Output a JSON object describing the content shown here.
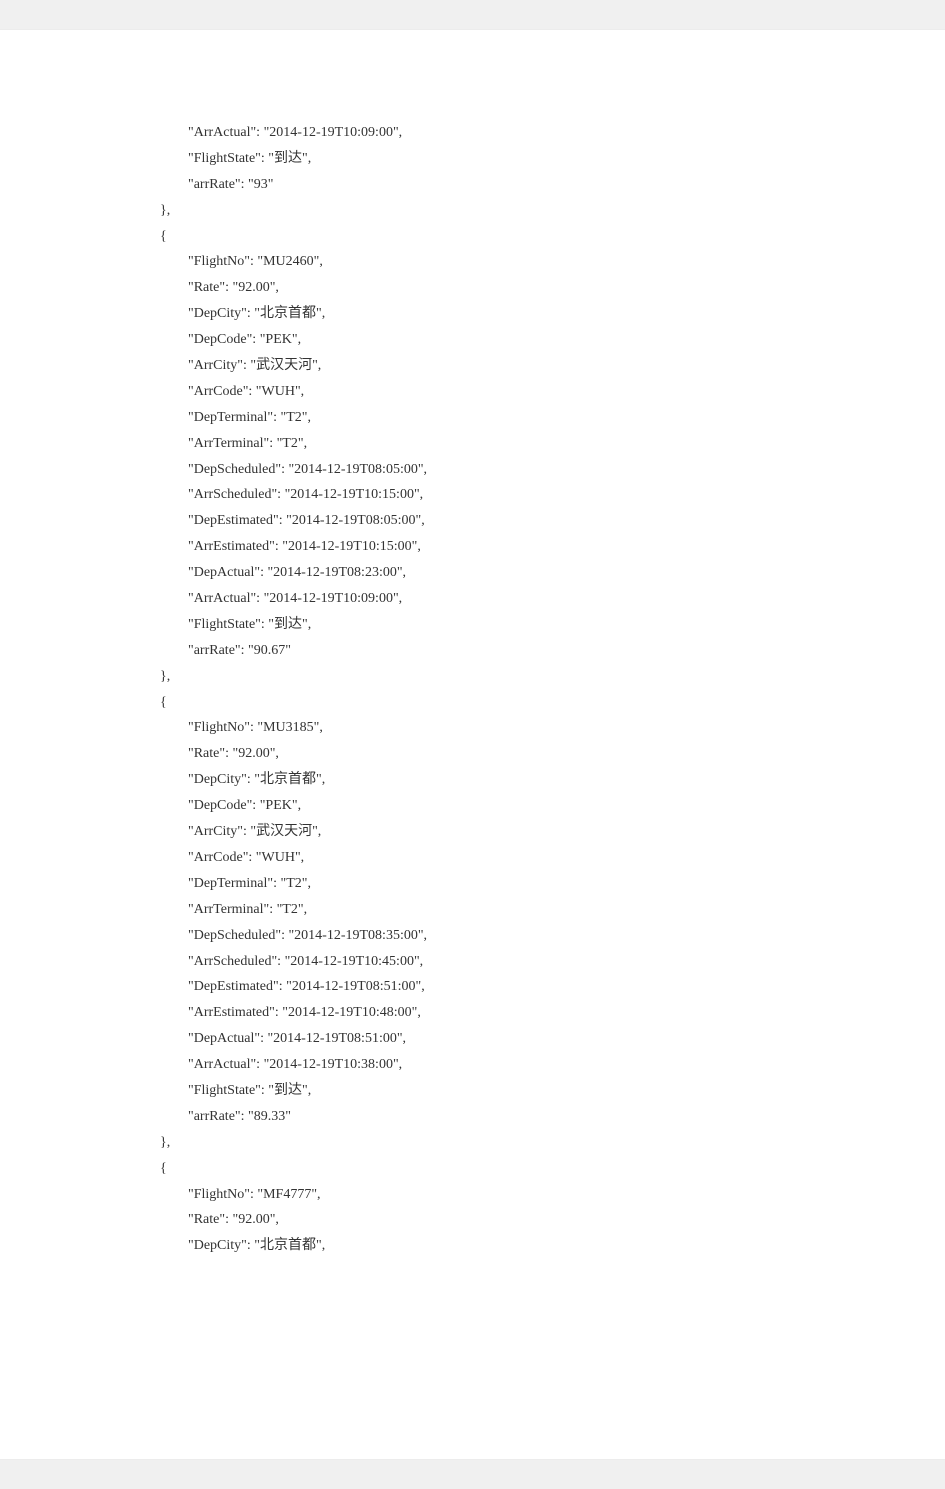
{
  "page": {
    "lines": [
      "        \"ArrActual\": \"2014-12-19T10:09:00\",",
      "        \"FlightState\": \"到达\",",
      "        \"arrRate\": \"93\"",
      "},",
      "{",
      "        \"FlightNo\": \"MU2460\",",
      "        \"Rate\": \"92.00\",",
      "        \"DepCity\": \"北京首都\",",
      "        \"DepCode\": \"PEK\",",
      "        \"ArrCity\": \"武汉天河\",",
      "        \"ArrCode\": \"WUH\",",
      "        \"DepTerminal\": \"T2\",",
      "        \"ArrTerminal\": \"T2\",",
      "        \"DepScheduled\": \"2014-12-19T08:05:00\",",
      "        \"ArrScheduled\": \"2014-12-19T10:15:00\",",
      "        \"DepEstimated\": \"2014-12-19T08:05:00\",",
      "        \"ArrEstimated\": \"2014-12-19T10:15:00\",",
      "        \"DepActual\": \"2014-12-19T08:23:00\",",
      "        \"ArrActual\": \"2014-12-19T10:09:00\",",
      "        \"FlightState\": \"到达\",",
      "        \"arrRate\": \"90.67\"",
      "},",
      "{",
      "        \"FlightNo\": \"MU3185\",",
      "        \"Rate\": \"92.00\",",
      "        \"DepCity\": \"北京首都\",",
      "        \"DepCode\": \"PEK\",",
      "        \"ArrCity\": \"武汉天河\",",
      "        \"ArrCode\": \"WUH\",",
      "        \"DepTerminal\": \"T2\",",
      "        \"ArrTerminal\": \"T2\",",
      "        \"DepScheduled\": \"2014-12-19T08:35:00\",",
      "        \"ArrScheduled\": \"2014-12-19T10:45:00\",",
      "        \"DepEstimated\": \"2014-12-19T08:51:00\",",
      "        \"ArrEstimated\": \"2014-12-19T10:48:00\",",
      "        \"DepActual\": \"2014-12-19T08:51:00\",",
      "        \"ArrActual\": \"2014-12-19T10:38:00\",",
      "        \"FlightState\": \"到达\",",
      "        \"arrRate\": \"89.33\"",
      "},",
      "{",
      "        \"FlightNo\": \"MF4777\",",
      "        \"Rate\": \"92.00\",",
      "        \"DepCity\": \"北京首都\","
    ]
  }
}
